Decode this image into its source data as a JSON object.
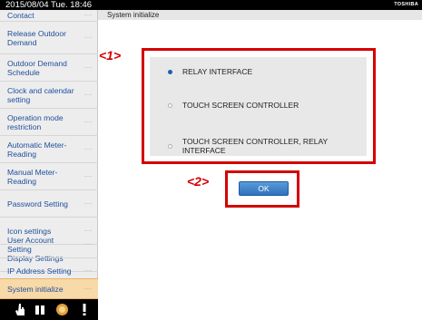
{
  "topbar": {
    "datetime": "2015/08/04 Tue. 18:46",
    "brand": "TOSHIBA"
  },
  "page": {
    "title": "System initialize"
  },
  "sidebar": {
    "items": [
      {
        "label": "Contact",
        "active": false
      },
      {
        "label": "Release Outdoor Demand",
        "active": false
      },
      {
        "label": "Outdoor Demand Schedule",
        "active": false
      },
      {
        "label": "Clock and calendar setting",
        "active": false
      },
      {
        "label": "Operation mode restriction",
        "active": false
      },
      {
        "label": "Automatic Meter-Reading",
        "active": false
      },
      {
        "label": "Manual Meter-Reading",
        "active": false
      },
      {
        "label": "Password Setting",
        "active": false
      },
      {
        "label": "Icon settings",
        "active": false
      },
      {
        "label": "Display Settings",
        "active": false
      },
      {
        "label": "User Account Setting",
        "active": false
      },
      {
        "label": "IP Address Setting",
        "active": false
      },
      {
        "label": "System initialize",
        "active": true
      }
    ],
    "more_glyph": "···"
  },
  "bottom_icons": [
    "hand-pointer-icon",
    "book-icon",
    "sun-icon",
    "alert-icon"
  ],
  "options": [
    {
      "label": "RELAY INTERFACE",
      "selected": true
    },
    {
      "label": "TOUCH SCREEN CONTROLLER",
      "selected": false
    },
    {
      "label": "TOUCH SCREEN CONTROLLER, RELAY INTERFACE",
      "selected": false
    }
  ],
  "ok_button": {
    "label": "OK"
  },
  "callouts": {
    "one": "<1>",
    "two": "<2>"
  },
  "colors": {
    "callout_red": "#d40000",
    "accent_blue": "#2f72be",
    "menu_text": "#1f4e9c",
    "active_bg": "#f8d9a8"
  }
}
